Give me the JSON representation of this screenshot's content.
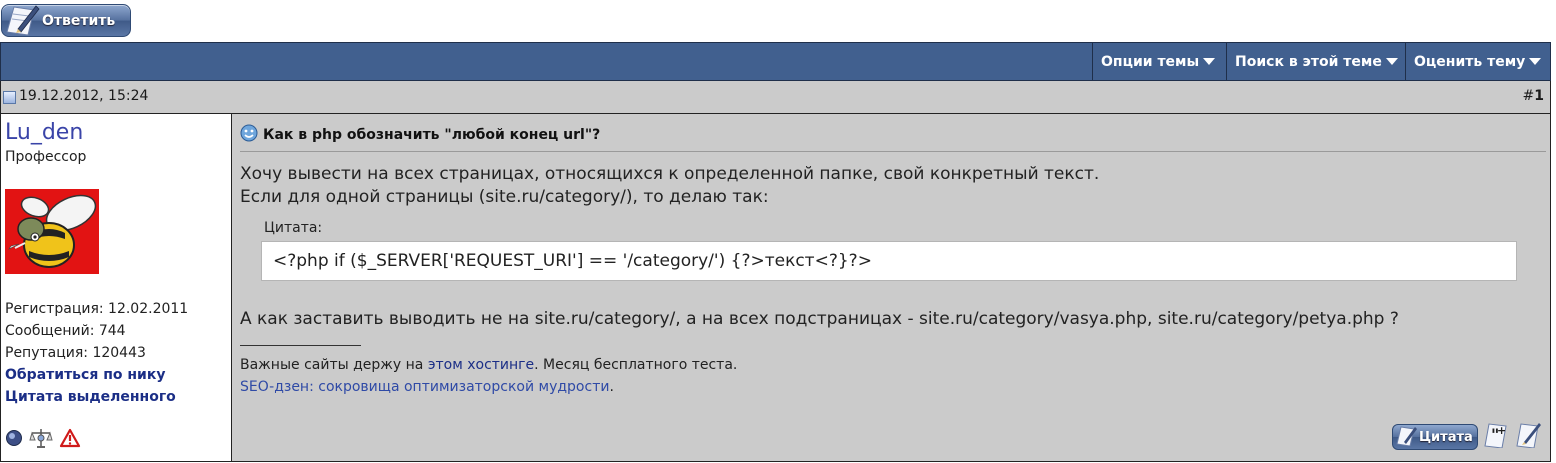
{
  "top": {
    "reply_label": "Ответить"
  },
  "toolbar": {
    "thread_options": "Опции темы",
    "search_thread": "Поиск в этой теме",
    "rate_thread": "Оценить тему"
  },
  "post": {
    "date": "19.12.2012, 15:24",
    "number_prefix": "#",
    "number": "1",
    "title": "Как в php обозначить \"любой конец url\"?",
    "line1": "Хочу вывести на всех страницах, относящихся к определенной папке, свой конкретный текст.",
    "line2": "Если для одной страницы (site.ru/category/), то делаю так:",
    "quote_label": "Цитата:",
    "quote_text": "<?php if ($_SERVER['REQUEST_URI'] == '/category/') {?>текст<?}?>",
    "line3": "А как заставить выводить не на site.ru/category/, а на всех подстраницах - site.ru/category/vasya.php, site.ru/category/petya.php ?",
    "signature": {
      "line": "__________________",
      "s1_before": "Важные сайты держу на ",
      "s1_link": "этом хостинге",
      "s1_after": ". Месяц бесплатного теста.",
      "s2_link": "SEO-дзен: сокровища оптимизаторской мудрости",
      "s2_after": "."
    },
    "quote_button": "Цитата"
  },
  "user": {
    "name": "Lu_den",
    "title": "Профессор",
    "registration": "Регистрация: 12.02.2011",
    "messages": "Сообщений: 744",
    "reputation": "Репутация: 120443",
    "link_nick": "Обратиться по нику",
    "link_quote": "Цитата выделенного"
  },
  "colors": {
    "toolbar_bg": "#41608f",
    "post_bg": "#cbcbcb",
    "username": "#3a44a8",
    "link_bold": "#1b2e86",
    "avatar_bg": "#e21313"
  },
  "icons": {
    "reply": "pencil-paper-icon",
    "user_status": "offline-status-icon",
    "reputation": "reputation-scales-icon",
    "report": "report-warning-icon",
    "quote": "quote-icon",
    "multi_quote": "multiquote-icon",
    "quick_reply": "quick-reply-icon"
  }
}
